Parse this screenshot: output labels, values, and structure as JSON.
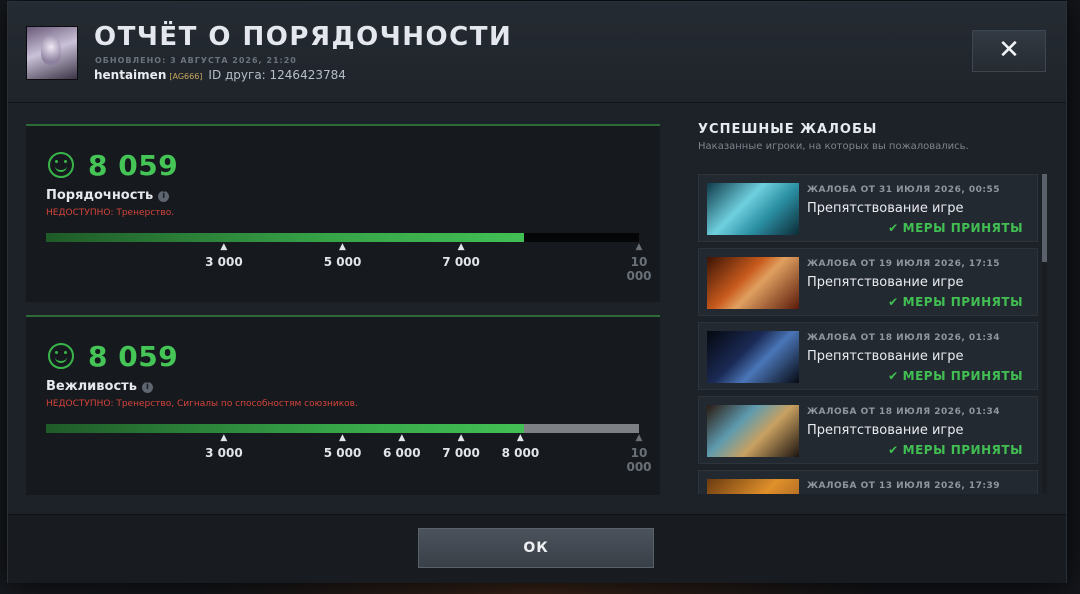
{
  "header": {
    "title": "ОТЧЁТ О ПОРЯДОЧНОСТИ",
    "updated": "ОБНОВЛЕНО: 3 АВГУСТА 2026, 21:20",
    "username": "hentaimen",
    "tag": "[AG666]",
    "friend_id": "ID друга: 1246423784",
    "close_label": "✕"
  },
  "metrics": [
    {
      "score": "8 059",
      "label": "Порядочность",
      "unavailable": "НЕДОСТУПНО: Тренерство.",
      "progress_value": 8059,
      "scale_max": 10000,
      "ticks": [
        {
          "label": "3 000",
          "value": 3000,
          "reached": true
        },
        {
          "label": "5 000",
          "value": 5000,
          "reached": true
        },
        {
          "label": "7 000",
          "value": 7000,
          "reached": true
        },
        {
          "label": "10 000",
          "value": 10000,
          "reached": false
        }
      ]
    },
    {
      "score": "8 059",
      "label": "Вежливость",
      "unavailable": "НЕДОСТУПНО: Тренерство, Сигналы по способностям союзников.",
      "progress_value": 8059,
      "scale_max": 10000,
      "ticks": [
        {
          "label": "3 000",
          "value": 3000,
          "reached": true
        },
        {
          "label": "5 000",
          "value": 5000,
          "reached": true
        },
        {
          "label": "6 000",
          "value": 6000,
          "reached": true
        },
        {
          "label": "7 000",
          "value": 7000,
          "reached": true
        },
        {
          "label": "8 000",
          "value": 8000,
          "reached": true
        },
        {
          "label": "10 000",
          "value": 10000,
          "reached": false
        }
      ]
    }
  ],
  "reports_section": {
    "title": "УСПЕШНЫЕ ЖАЛОБЫ",
    "subtitle": "Наказанные игроки, на которых вы пожаловались.",
    "items": [
      {
        "date": "ЖАЛОБА ОТ 31 ИЮЛЯ 2026, 00:55",
        "reason": "Препятствование игре",
        "status": "МЕРЫ ПРИНЯТЫ"
      },
      {
        "date": "ЖАЛОБА ОТ 19 ИЮЛЯ 2026, 17:15",
        "reason": "Препятствование игре",
        "status": "МЕРЫ ПРИНЯТЫ"
      },
      {
        "date": "ЖАЛОБА ОТ 18 ИЮЛЯ 2026, 01:34",
        "reason": "Препятствование игре",
        "status": "МЕРЫ ПРИНЯТЫ"
      },
      {
        "date": "ЖАЛОБА ОТ 18 ИЮЛЯ 2026, 01:34",
        "reason": "Препятствование игре",
        "status": "МЕРЫ ПРИНЯТЫ"
      },
      {
        "date": "ЖАЛОБА ОТ 13 ИЮЛЯ 2026, 17:39",
        "reason": "",
        "status": ""
      }
    ]
  },
  "footer": {
    "ok_label": "ОК"
  },
  "colors": {
    "accent_green": "#45c556",
    "error_red": "#d4433a",
    "bg_panel": "#161a1f"
  }
}
